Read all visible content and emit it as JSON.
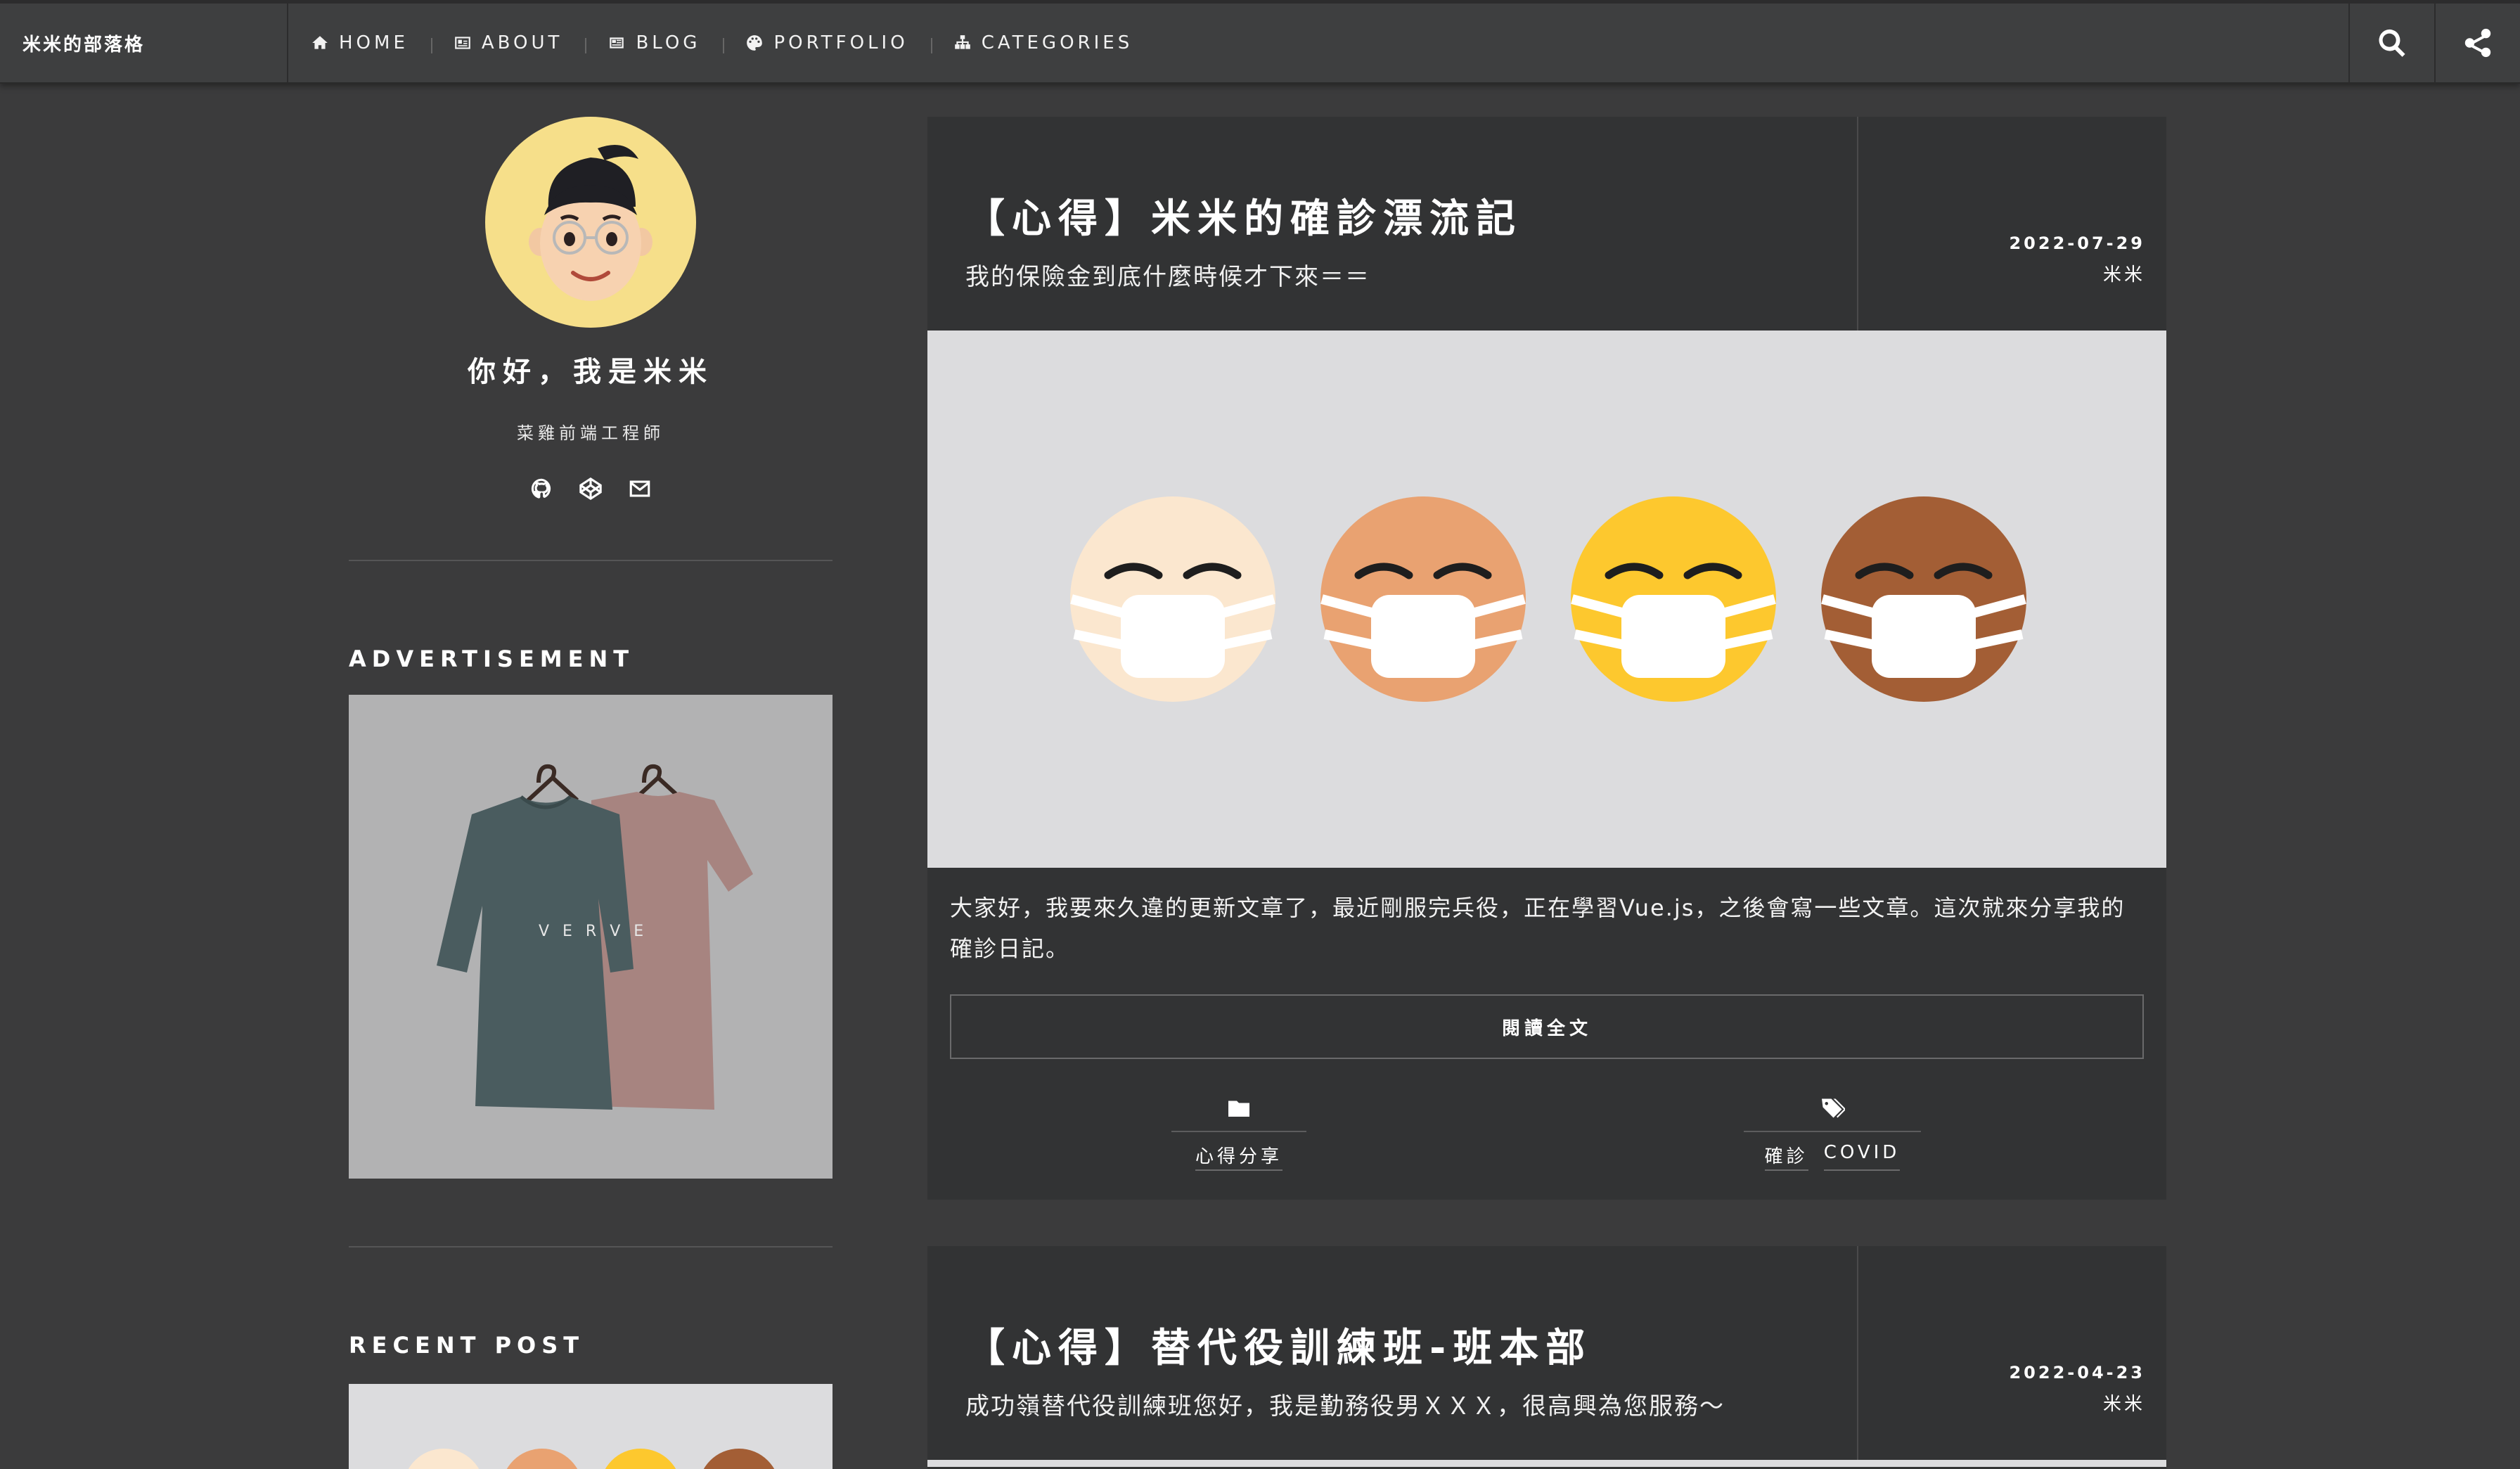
{
  "site": {
    "brand": "米米的部落格"
  },
  "nav": {
    "items": [
      {
        "label": "HOME",
        "icon": "home-icon"
      },
      {
        "label": "ABOUT",
        "icon": "id-card-icon"
      },
      {
        "label": "BLOG",
        "icon": "newspaper-icon"
      },
      {
        "label": "PORTFOLIO",
        "icon": "palette-icon"
      },
      {
        "label": "CATEGORIES",
        "icon": "sitemap-icon"
      }
    ],
    "search_icon": "search-icon",
    "share_icon": "share-icon"
  },
  "profile": {
    "name": "你好，我是米米",
    "title": "菜雞前端工程師",
    "social": [
      "github-icon",
      "codepen-icon",
      "envelope-icon"
    ]
  },
  "sidebar": {
    "ad_heading": "ADVERTISEMENT",
    "ad_shirt_text": "V E R V E",
    "recent_heading": "RECENT POST"
  },
  "posts": [
    {
      "title": "【心得】米米的確診漂流記",
      "subtitle": "我的保險金到底什麼時候才下來＝＝",
      "date": "2022-07-29",
      "author": "米米",
      "excerpt": "大家好，我要來久違的更新文章了，最近剛服完兵役，正在學習Vue.js，之後會寫一些文章。這次就來分享我的確診日記。",
      "read_more": "閱讀全文",
      "category": "心得分享",
      "tags": [
        "確診",
        "COVID"
      ],
      "emoji_colors": [
        "#fbe7cf",
        "#e9a271",
        "#fdc82e",
        "#a35e35"
      ]
    },
    {
      "title": "【心得】替代役訓練班-班本部",
      "subtitle": "成功嶺替代役訓練班您好，我是勤務役男ＸＸＸ，很高興為您服務～",
      "date": "2022-04-23",
      "author": "米米"
    }
  ],
  "colors": {
    "background": "#3b3b3c",
    "panel": "#323334",
    "nav": "#3e3f40"
  }
}
